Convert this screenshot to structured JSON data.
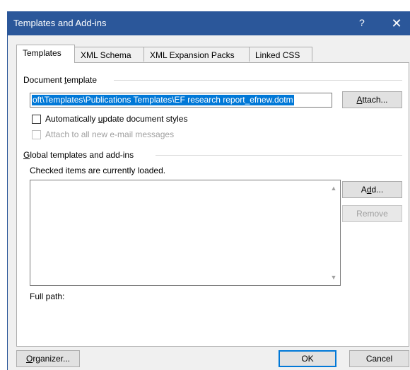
{
  "window": {
    "title": "Templates and Add-ins",
    "help_label": "?",
    "close_label": "✕",
    "colors": {
      "titlebar": "#2b579a",
      "selection": "#0078d7"
    }
  },
  "tabs": [
    {
      "label": "Templates",
      "active": true
    },
    {
      "label": "XML Schema"
    },
    {
      "label": "XML Expansion Packs"
    },
    {
      "label": "Linked CSS"
    }
  ],
  "document_template": {
    "section_pre": "Document ",
    "section_key": "t",
    "section_post": "emplate",
    "path_value": "oft\\Templates\\Publications Templates\\EF research report_efnew.dotm",
    "attach_pre": "",
    "attach_key": "A",
    "attach_post": "ttach...",
    "auto_update_pre": "Automatically ",
    "auto_update_key": "u",
    "auto_update_post": "pdate document styles",
    "auto_update_checked": false,
    "attach_email_label": "Attach to all new e-mail messages",
    "attach_email_checked": false
  },
  "global_templates": {
    "section_pre": "",
    "section_key": "G",
    "section_post": "lobal templates and add-ins",
    "hint": "Checked items are currently loaded.",
    "items": [],
    "add_pre": "A",
    "add_key": "d",
    "add_post": "d...",
    "remove_label": "Remove",
    "full_path_label": "Full path:",
    "scroll_up_icon": "▲",
    "scroll_down_icon": "▼"
  },
  "footer": {
    "organizer_pre": "",
    "organizer_key": "O",
    "organizer_post": "rganizer...",
    "ok_label": "OK",
    "cancel_label": "Cancel"
  }
}
